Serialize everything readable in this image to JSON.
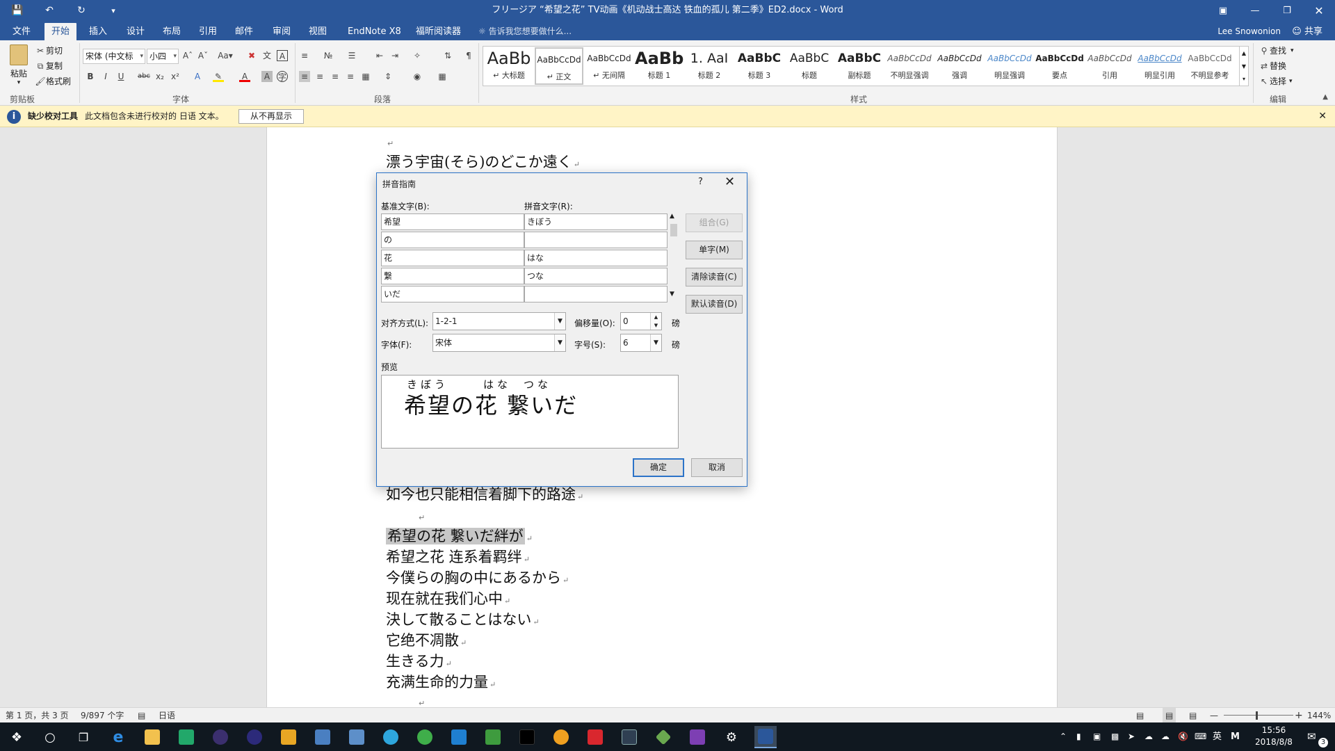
{
  "window": {
    "title": "フリージア “希望之花” TV动画《机动战士高达 铁血的孤儿 第二季》ED2.docx - Word",
    "quick_access": [
      "save-icon",
      "undo-icon",
      "redo-icon",
      "customize-icon"
    ]
  },
  "ribbon_tabs": [
    "文件",
    "开始",
    "插入",
    "设计",
    "布局",
    "引用",
    "邮件",
    "审阅",
    "视图",
    "EndNote X8",
    "福昕阅读器"
  ],
  "active_tab": "开始",
  "tell_me": "告诉我您想要做什么...",
  "user": "Lee Snowonion",
  "share": "共享",
  "clipboard": {
    "paste": "粘贴",
    "cut": "剪切",
    "copy": "复制",
    "format_painter": "格式刷",
    "label": "剪贴板"
  },
  "font_group": {
    "font_name": "宋体 (中文标",
    "font_size": "小四",
    "label": "字体"
  },
  "paragraph_group": {
    "label": "段落"
  },
  "styles_group": {
    "label": "样式",
    "items": [
      {
        "preview": "AaBb",
        "name": "↵ 大标题"
      },
      {
        "preview": "AaBbCcDd",
        "name": "↵ 正文"
      },
      {
        "preview": "AaBbCcDd",
        "name": "↵ 无间隔"
      },
      {
        "preview": "AaBb",
        "name": "标题 1"
      },
      {
        "preview": "1. AaI",
        "name": "标题 2"
      },
      {
        "preview": "AaBbC",
        "name": "标题 3"
      },
      {
        "preview": "AaBbC",
        "name": "标题"
      },
      {
        "preview": "AaBbC",
        "name": "副标题"
      },
      {
        "preview": "AaBbCcDd",
        "name": "不明显强调"
      },
      {
        "preview": "AaBbCcDd",
        "name": "强调"
      },
      {
        "preview": "AaBbCcDd",
        "name": "明显强调"
      },
      {
        "preview": "AaBbCcDd",
        "name": "要点"
      },
      {
        "preview": "AaBbCcDd",
        "name": "引用"
      },
      {
        "preview": "AaBbCcDd",
        "name": "明显引用"
      },
      {
        "preview": "AaBbCcDd",
        "name": "不明显参考"
      }
    ]
  },
  "editing_group": {
    "find": "查找",
    "replace": "替换",
    "select": "选择",
    "label": "编辑"
  },
  "infobar": {
    "title": "缺少校对工具",
    "message": "此文档包含未进行校对的 日语 文本。",
    "button": "从不再显示"
  },
  "document_lines": [
    "漂う宇宙(そら)のどこか遠く",
    "如今也只能相信着脚下的路途",
    "希望の花  繋いだ絆が",
    "希望之花  连系着羁绊",
    "今僕らの胸の中にあるから",
    "现在就在我们心中",
    "決して散ることはない",
    "它绝不凋散",
    "生きる力",
    "充满生命的力量"
  ],
  "dialog": {
    "title": "拼音指南",
    "help": "?",
    "base_label": "基准文字(B):",
    "ruby_label": "拼音文字(R):",
    "rows": [
      {
        "base": "希望",
        "ruby": "きぼう"
      },
      {
        "base": "の",
        "ruby": ""
      },
      {
        "base": "花",
        "ruby": "はな"
      },
      {
        "base": "繋",
        "ruby": "つな"
      },
      {
        "base": "いだ",
        "ruby": ""
      }
    ],
    "buttons": {
      "group": "组合(G)",
      "mono": "单字(M)",
      "clear": "清除读音(C)",
      "default": "默认读音(D)",
      "ok": "确定",
      "cancel": "取消"
    },
    "align_label": "对齐方式(L):",
    "align_value": "1-2-1",
    "offset_label": "偏移量(O):",
    "offset_value": "0",
    "font_label": "字体(F):",
    "font_value": "宋体",
    "size_label": "字号(S):",
    "size_value": "6",
    "unit": "磅",
    "preview_label": "预览",
    "preview_text": "希望の花 繋いだ",
    "preview_ruby": [
      "きぼう",
      "はな",
      "つな"
    ]
  },
  "statusbar": {
    "page": "第 1 页，共 3 页",
    "words": "9/897 个字",
    "language": "日语",
    "zoom": "144%"
  },
  "taskbar": {
    "time": "15:56",
    "date": "2018/8/8",
    "ime": "英",
    "notifications": "3"
  },
  "colors": {
    "word_blue": "#2b579a",
    "infobar": "#fff4c6",
    "taskbar": "#101820"
  }
}
